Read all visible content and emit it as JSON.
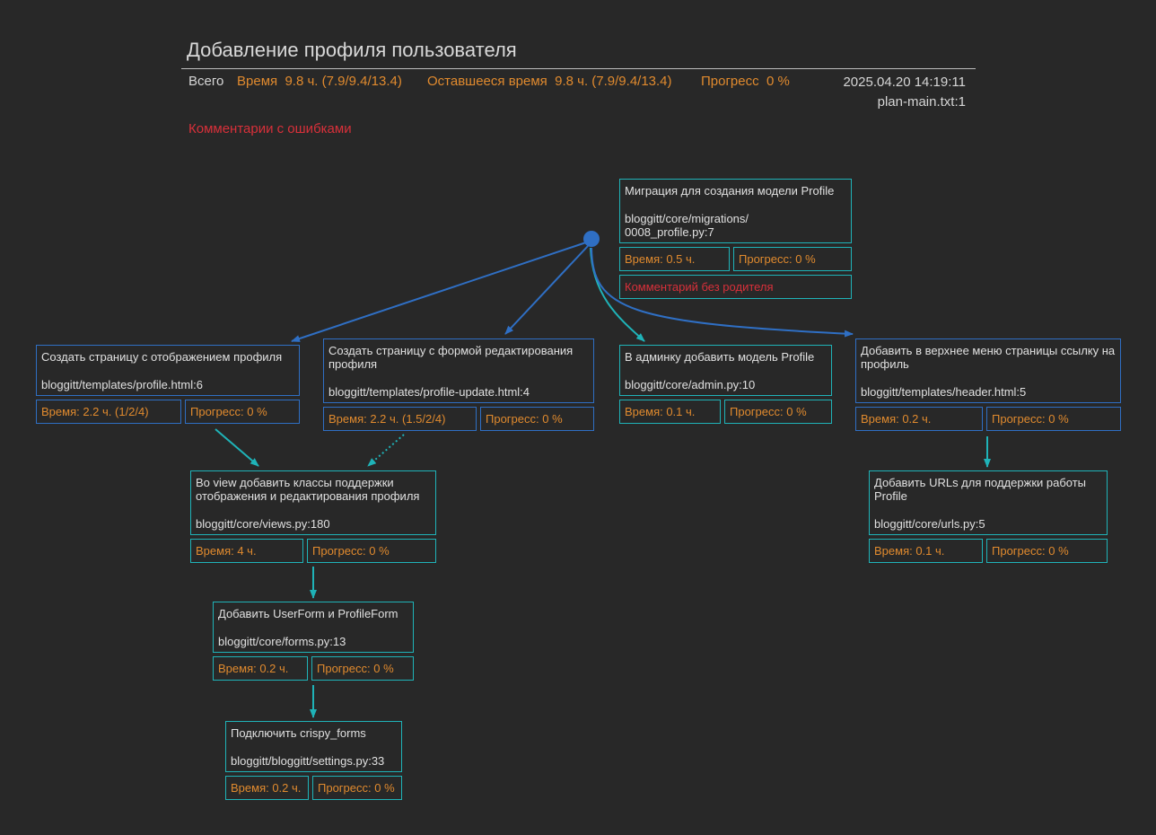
{
  "header": {
    "title": "Добавление профиля пользователя",
    "total_label": "Всего",
    "time_label": "Время",
    "time_value": "9.8 ч. (7.9/9.4/13.4)",
    "remaining_label": "Оставшееся время",
    "remaining_value": "9.8 ч. (7.9/9.4/13.4)",
    "progress_label": "Прогресс",
    "progress_value": "0 %",
    "datetime": "2025.04.20 14:19:11",
    "source": "plan-main.txt:1",
    "errors_link": "Комментарии с ошибками"
  },
  "colors": {
    "background": "#282828",
    "blue": "#2f6fc4",
    "teal": "#1fb3b8",
    "orange": "#e08a2e",
    "red": "#d8303a"
  },
  "nodes": {
    "migration": {
      "title": "Миграция для создания модели Profile",
      "path": "bloggitt/core/migrations/ 0008_profile.py:7",
      "time": "Время: 0.5 ч.",
      "progress": "Прогресс: 0 %",
      "comment": "Комментарий без родителя"
    },
    "profile_page": {
      "title": "Создать страницу с отображением профиля",
      "path": "bloggitt/templates/profile.html:6",
      "time": "Время: 2.2 ч. (1/2/4)",
      "progress": "Прогресс: 0 %"
    },
    "profile_edit": {
      "title": "Создать страницу с формой редактирования профиля",
      "path": "bloggitt/templates/profile-update.html:4",
      "time": "Время: 2.2 ч. (1.5/2/4)",
      "progress": "Прогресс: 0 %"
    },
    "admin": {
      "title": "В админку добавить модель Profile",
      "path": "bloggitt/core/admin.py:10",
      "time": "Время: 0.1 ч.",
      "progress": "Прогресс: 0 %"
    },
    "menu": {
      "title": "Добавить в верхнее меню страницы ссылку на профиль",
      "path": "bloggitt/templates/header.html:5",
      "time": "Время: 0.2 ч.",
      "progress": "Прогресс: 0 %"
    },
    "views": {
      "title": "Во view добавить классы поддержки отображения и редактирования профиля",
      "path": "bloggitt/core/views.py:180",
      "time": "Время: 4 ч.",
      "progress": "Прогресс: 0 %"
    },
    "urls": {
      "title": "Добавить URLs для поддержки работы Profile",
      "path": "bloggitt/core/urls.py:5",
      "time": "Время: 0.1 ч.",
      "progress": "Прогресс: 0 %"
    },
    "forms": {
      "title": "Добавить UserForm и ProfileForm",
      "path": "bloggitt/core/forms.py:13",
      "time": "Время: 0.2 ч.",
      "progress": "Прогресс: 0 %"
    },
    "crispy": {
      "title": "Подключить crispy_forms",
      "path": "bloggitt/bloggitt/settings.py:33",
      "time": "Время: 0.2 ч.",
      "progress": "Прогресс: 0 %"
    }
  }
}
